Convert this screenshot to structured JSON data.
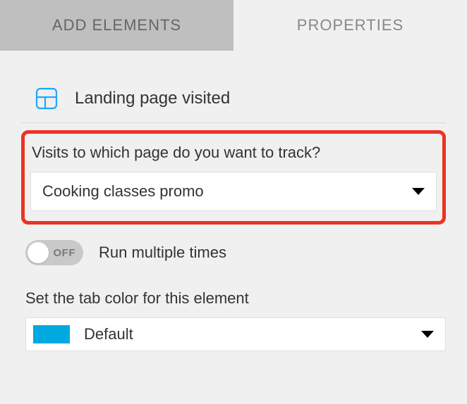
{
  "tabs": {
    "add_elements": "ADD ELEMENTS",
    "properties": "PROPERTIES"
  },
  "header": {
    "title": "Landing page visited"
  },
  "page_field": {
    "label": "Visits to which page do you want to track?",
    "selected": "Cooking classes promo"
  },
  "toggle": {
    "state_text": "OFF",
    "label": "Run multiple times"
  },
  "color_field": {
    "label": "Set the tab color for this element",
    "selected": "Default",
    "swatch_hex": "#00a9e0"
  }
}
